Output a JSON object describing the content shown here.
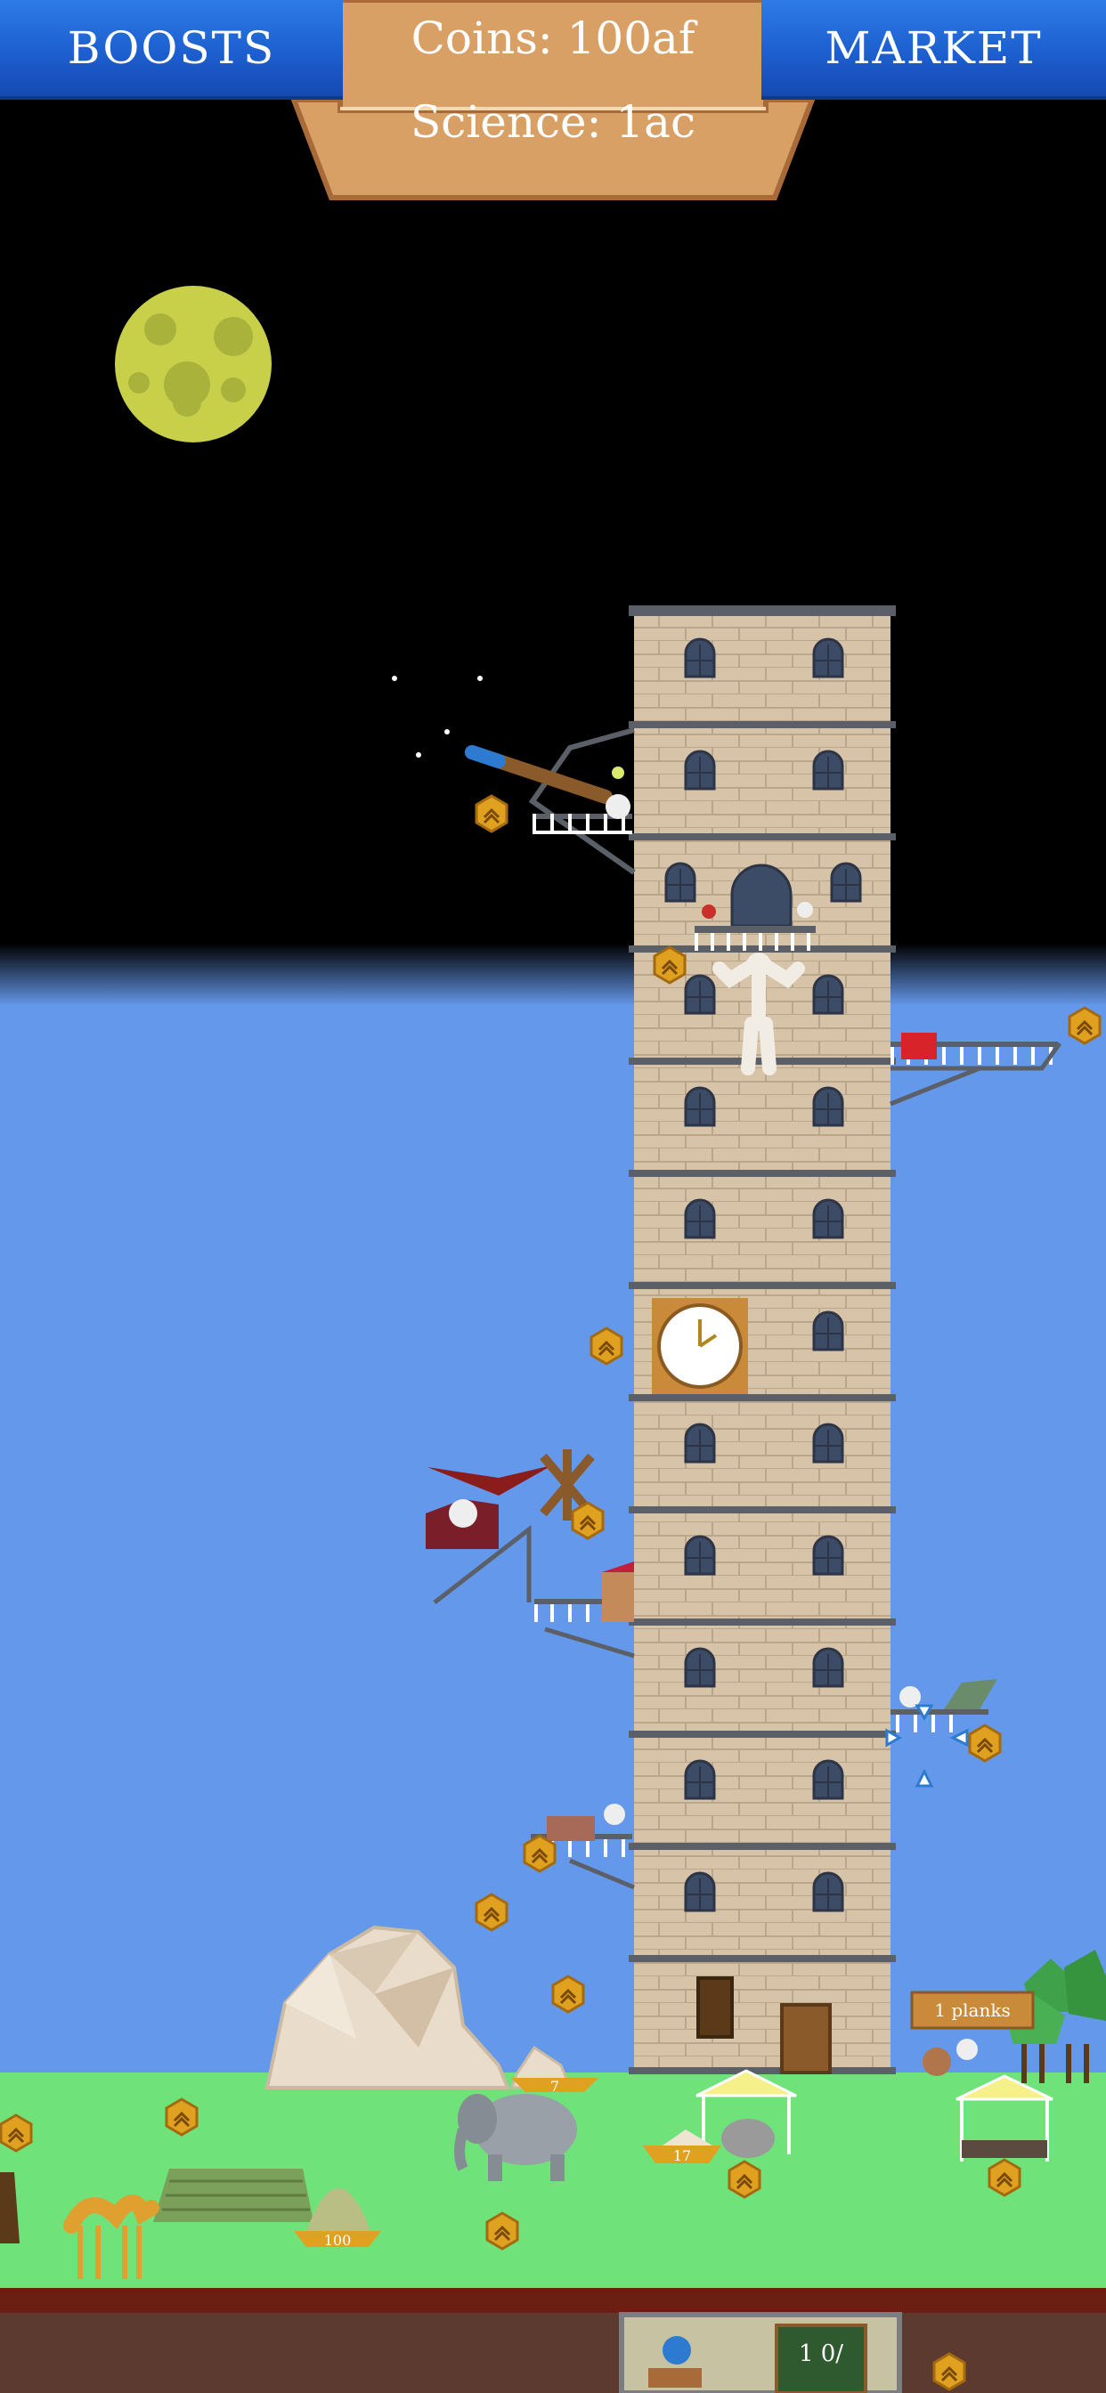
{
  "hud": {
    "boosts_label": "BOOSTS",
    "market_label": "MARKET",
    "coins_text": "Coins:  100af",
    "science_text": "Science:  1ac"
  },
  "world": {
    "planks_sign": "1 planks",
    "stockpile_left_count": "7",
    "hay_count": "100",
    "stone_count": "17"
  },
  "colors": {
    "sky_day": "#6498ea",
    "space": "#000000",
    "grass": "#6fe27a",
    "ground_strip": "#6b1f12",
    "bottom_panel": "#5d3a30",
    "tower_brick": "#d6c3a8",
    "hud_blue": "#1d5fd0",
    "sign_wood": "#d9a066",
    "coin": "#e0a020"
  }
}
